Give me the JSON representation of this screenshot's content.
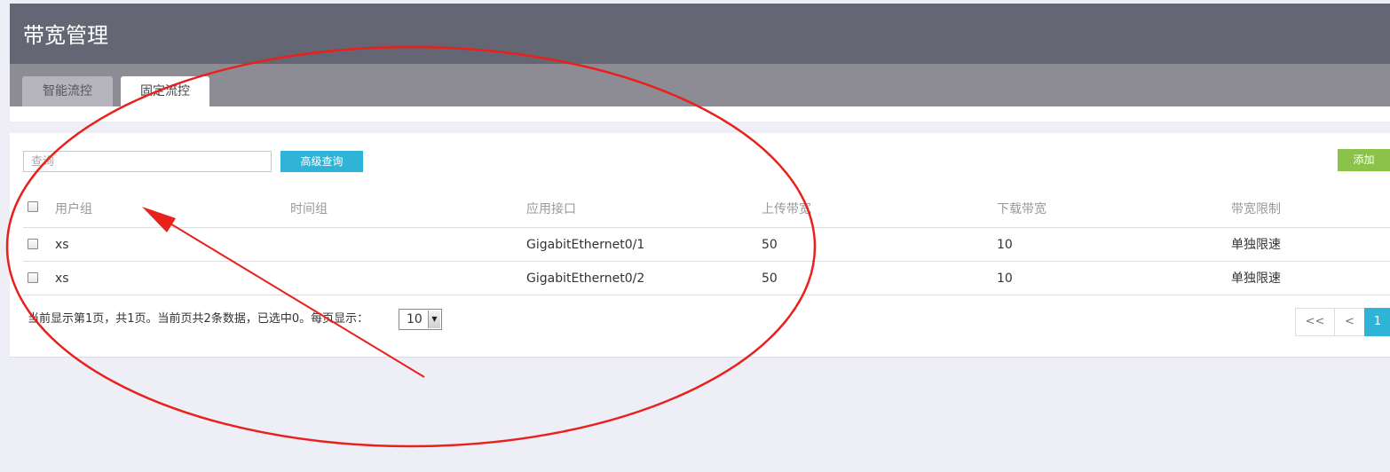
{
  "header": {
    "title": "带宽管理"
  },
  "tabs": [
    {
      "label": "智能流控",
      "active": false
    },
    {
      "label": "固定流控",
      "active": true
    }
  ],
  "toolbar": {
    "search_placeholder": "查询",
    "advanced_search_label": "高级查询",
    "add_label": "添加"
  },
  "table": {
    "columns": [
      "用户组",
      "时间组",
      "应用接口",
      "上传带宽",
      "下载带宽",
      "带宽限制"
    ],
    "rows": [
      [
        "xs",
        "",
        "GigabitEthernet0/1",
        "50",
        "10",
        "单独限速"
      ],
      [
        "xs",
        "",
        "GigabitEthernet0/2",
        "50",
        "10",
        "单独限速"
      ]
    ]
  },
  "footer": {
    "status_text": "当前显示第1页，共1页。当前页共2条数据，已选中0。每页显示：",
    "page_size": "10"
  },
  "pagination": {
    "first_label": "<<",
    "prev_label": "<",
    "current_page": "1"
  },
  "colors": {
    "header_bg": "#646674",
    "tabbar_bg": "#8d8c95",
    "accent": "#2fb3d6",
    "add_button": "#8bc34a",
    "annotation_red": "#e8211c"
  }
}
